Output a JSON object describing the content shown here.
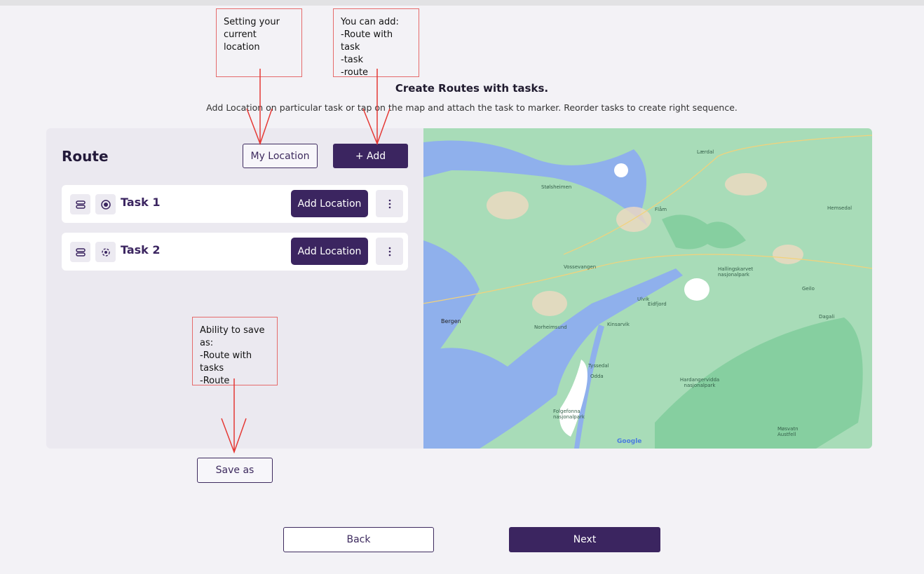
{
  "header": {
    "title": "Create Routes with tasks.",
    "subtitle": "Add Location on particular task or tap on the map and attach the task to marker. Reorder tasks to create right sequence."
  },
  "route": {
    "title": "Route",
    "my_location_label": "My Location",
    "add_label": "+ Add",
    "tasks": [
      {
        "name": "Task 1",
        "icon": "radio-target-icon",
        "add_location_label": "Add Location"
      },
      {
        "name": "Task 2",
        "icon": "move-target-icon",
        "add_location_label": "Add Location"
      }
    ],
    "save_as_label": "Save as"
  },
  "map": {
    "labels": [
      "Stølsheimen",
      "Vossevangen",
      "Bergen",
      "Norheimsund",
      "Hallingskarvet nasjonalpark",
      "Hardangervidda nasjonalpark",
      "Folgefonna nasjonalpark",
      "Ulvik",
      "Eidfjord",
      "Tyssedal",
      "Odda",
      "Geilo",
      "Dagali",
      "Møsvatn Austfell",
      "Hemsedal",
      "Lærdal",
      "Flåm",
      "Kinsarvik"
    ],
    "attribution": "Google"
  },
  "annotations": {
    "location_note": "Setting your\ncurrent location",
    "add_note": "You can add:\n-Route with task\n-task\n-route",
    "save_note": "Ability to save\nas:\n-Route with\ntasks\n-Route"
  },
  "footer": {
    "back_label": "Back",
    "next_label": "Next"
  },
  "colors": {
    "primary": "#3b2560",
    "annotation": "#e53935"
  }
}
